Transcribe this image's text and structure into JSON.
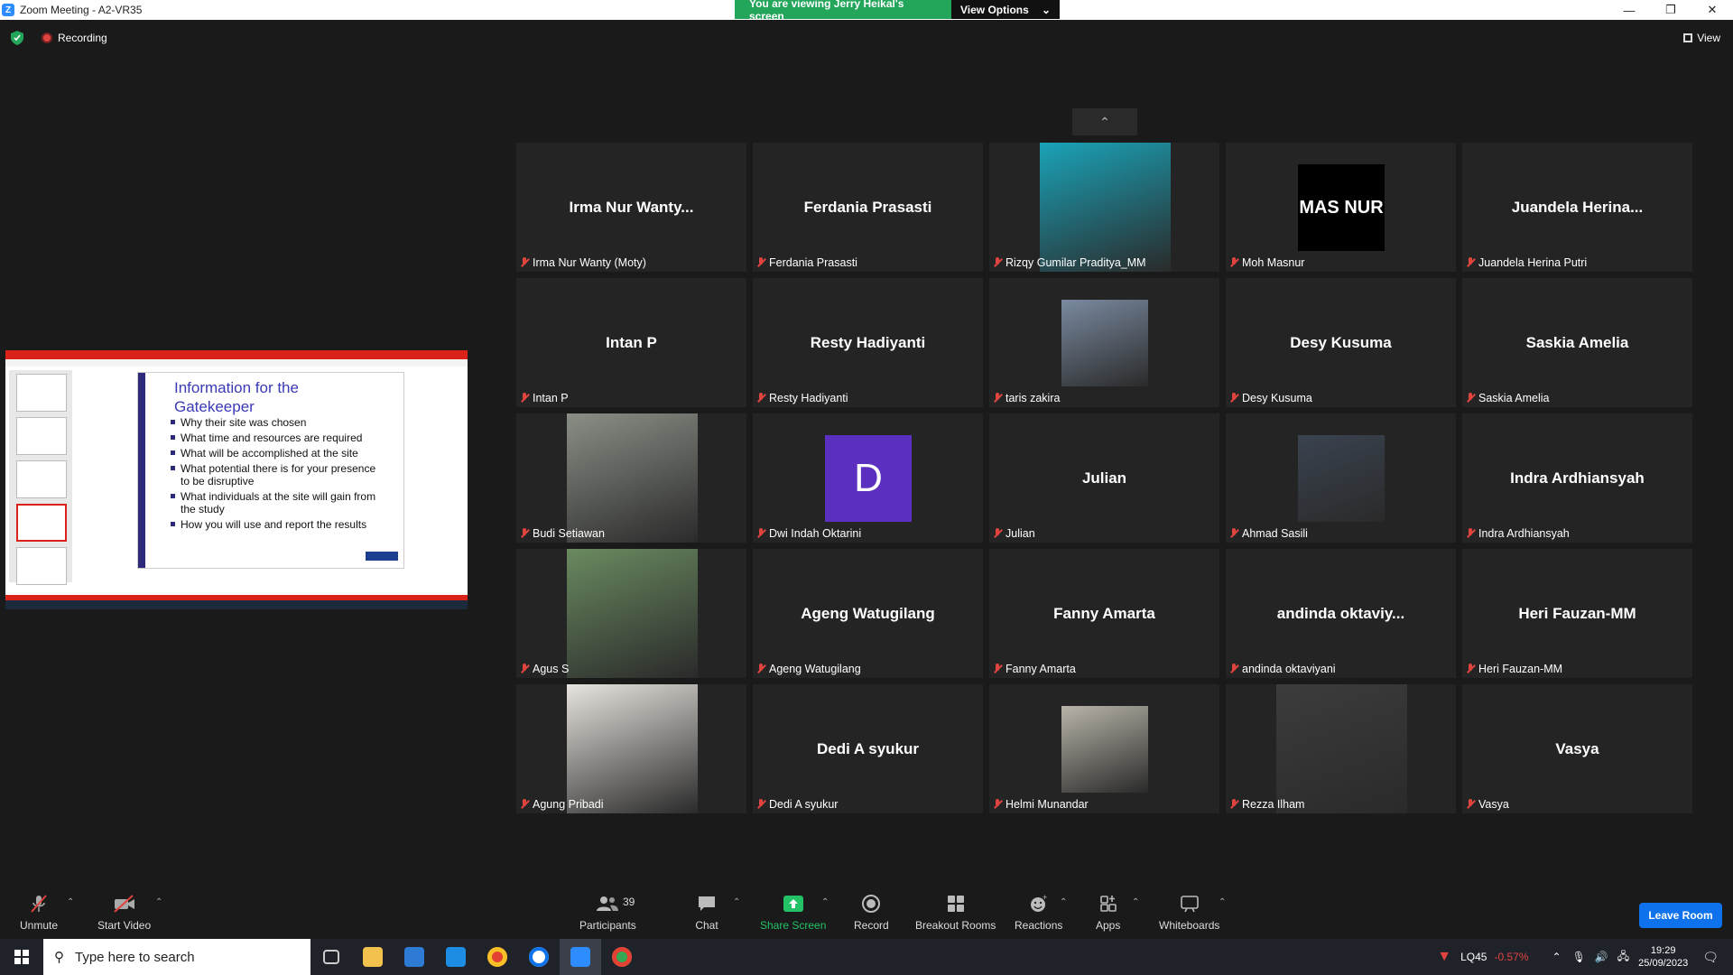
{
  "window": {
    "title": "Zoom Meeting - A2-VR35",
    "logo_letter": "Z"
  },
  "share_banner": {
    "viewing_text": "You are viewing Jerry Heikal's screen",
    "view_options": "View Options"
  },
  "status": {
    "recording": "Recording",
    "view": "View"
  },
  "shared_slide": {
    "title": "Information for the Gatekeeper",
    "bullets": [
      "Why their site was chosen",
      "What time and resources are required",
      "What will be accomplished at the site",
      "What potential there is for your presence to be disruptive",
      "What individuals at the site will gain from the study",
      "How you will use and report the results"
    ]
  },
  "participants": [
    {
      "display": "Irma Nur Wanty...",
      "name": "Irma Nur Wanty (Moty)",
      "kind": "text"
    },
    {
      "display": "Ferdania Prasasti",
      "name": "Ferdania Prasasti",
      "kind": "text"
    },
    {
      "display": "",
      "name": "Rizqy Gumilar Praditya_MM",
      "kind": "photo",
      "color": "#1aa3b8"
    },
    {
      "display": "MAS NUR",
      "name": "Moh Masnur",
      "kind": "logo"
    },
    {
      "display": "Juandela Herina...",
      "name": "Juandela Herina Putri",
      "kind": "text"
    },
    {
      "display": "Intan P",
      "name": "Intan P",
      "kind": "text"
    },
    {
      "display": "Resty Hadiyanti",
      "name": "Resty Hadiyanti",
      "kind": "text"
    },
    {
      "display": "",
      "name": "taris zakira",
      "kind": "photo-small",
      "color": "#7a8aa0"
    },
    {
      "display": "Desy Kusuma",
      "name": "Desy Kusuma",
      "kind": "text"
    },
    {
      "display": "Saskia Amelia",
      "name": "Saskia Amelia",
      "kind": "text"
    },
    {
      "display": "",
      "name": "Budi Setiawan",
      "kind": "photo",
      "color": "#8a8f86"
    },
    {
      "display": "D",
      "name": "Dwi Indah Oktarini",
      "kind": "letter"
    },
    {
      "display": "Julian",
      "name": "Julian",
      "kind": "text"
    },
    {
      "display": "",
      "name": "Ahmad Sasili",
      "kind": "photo-small",
      "color": "#3a4350"
    },
    {
      "display": "Indra Ardhiansyah",
      "name": "Indra Ardhiansyah",
      "kind": "text"
    },
    {
      "display": "",
      "name": "Agus S",
      "kind": "photo",
      "color": "#6a8a60"
    },
    {
      "display": "Ageng Watugilang",
      "name": "Ageng Watugilang",
      "kind": "text"
    },
    {
      "display": "Fanny Amarta",
      "name": "Fanny Amarta",
      "kind": "text"
    },
    {
      "display": "andinda  oktaviy...",
      "name": "andinda oktaviyani",
      "kind": "text"
    },
    {
      "display": "Heri Fauzan-MM",
      "name": "Heri Fauzan-MM",
      "kind": "text"
    },
    {
      "display": "",
      "name": "Agung Pribadi",
      "kind": "photo",
      "color": "#e8e4df"
    },
    {
      "display": "Dedi A syukur",
      "name": "Dedi A syukur",
      "kind": "text"
    },
    {
      "display": "",
      "name": "Helmi Munandar",
      "kind": "photo-small",
      "color": "#b8b4a8"
    },
    {
      "display": "",
      "name": "Rezza Ilham",
      "kind": "photo",
      "color": "#3c3c3c"
    },
    {
      "display": "Vasya",
      "name": "Vasya",
      "kind": "text"
    }
  ],
  "toolbar": {
    "unmute": "Unmute",
    "start_video": "Start Video",
    "participants": "Participants",
    "participants_count": "39",
    "chat": "Chat",
    "share_screen": "Share Screen",
    "record": "Record",
    "breakout_rooms": "Breakout Rooms",
    "reactions": "Reactions",
    "apps": "Apps",
    "whiteboards": "Whiteboards",
    "leave": "Leave Room"
  },
  "taskbar": {
    "search_placeholder": "Type here to search",
    "ticker": "LQ45",
    "ticker_change": "-0.57%",
    "time": "19:29",
    "date": "25/09/2023"
  },
  "colors": {
    "accent": "#0e72ed",
    "share_green": "#23a55a",
    "muted_red": "#e0443e",
    "letter_avatar": "#5b2fbf"
  }
}
